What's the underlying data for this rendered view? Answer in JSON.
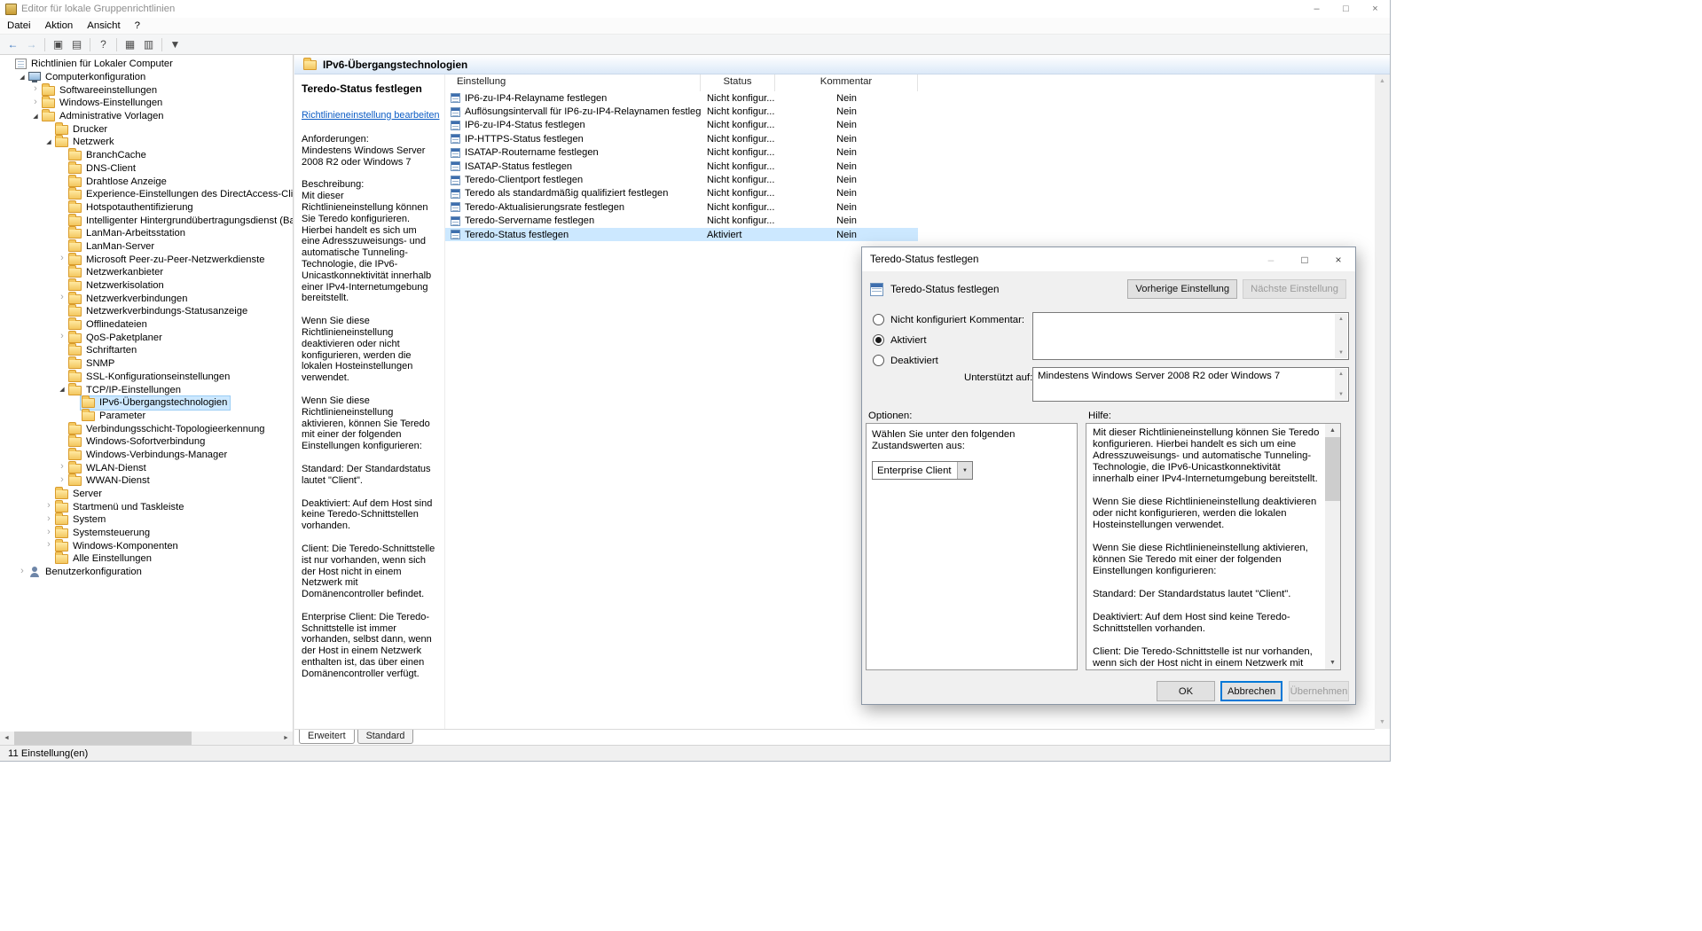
{
  "colors": {
    "selection_blue": "#cce8ff",
    "link_blue": "#0a5bc4",
    "accent_blue": "#0078d7",
    "folder_yellow": "#f3c75f"
  },
  "window": {
    "title": "Editor für lokale Gruppenrichtlinien",
    "menus": [
      "Datei",
      "Aktion",
      "Ansicht",
      "?"
    ],
    "status": "11 Einstellung(en)",
    "caption_buttons": [
      {
        "name": "minimize-button",
        "glyph": "–"
      },
      {
        "name": "maximize-button",
        "glyph": "□"
      },
      {
        "name": "close-button",
        "glyph": "×"
      }
    ],
    "toolbar": [
      {
        "name": "back-icon",
        "glyph": "←"
      },
      {
        "name": "forward-icon",
        "glyph": "→"
      },
      {
        "name": "separator"
      },
      {
        "name": "show-console-tree-icon",
        "glyph": "▣"
      },
      {
        "name": "export-list-icon",
        "glyph": "▤"
      },
      {
        "name": "separator"
      },
      {
        "name": "help-icon",
        "glyph": "?"
      },
      {
        "name": "separator"
      },
      {
        "name": "icon-view-icon",
        "glyph": "▦"
      },
      {
        "name": "list-view-icon",
        "glyph": "▥"
      },
      {
        "name": "separator"
      },
      {
        "name": "filter-icon",
        "glyph": "▼"
      }
    ]
  },
  "tree": [
    {
      "label": "Richtlinien für Lokaler Computer",
      "depth": 0,
      "chevron": "none",
      "icon": "console"
    },
    {
      "label": "Computerkonfiguration",
      "depth": 1,
      "chevron": "open",
      "icon": "computer"
    },
    {
      "label": "Softwareeinstellungen",
      "depth": 2,
      "chevron": "closed",
      "icon": "folder"
    },
    {
      "label": "Windows-Einstellungen",
      "depth": 2,
      "chevron": "closed",
      "icon": "folder"
    },
    {
      "label": "Administrative Vorlagen",
      "depth": 2,
      "chevron": "open",
      "icon": "folder"
    },
    {
      "label": "Drucker",
      "depth": 3,
      "chevron": "none",
      "icon": "folder"
    },
    {
      "label": "Netzwerk",
      "depth": 3,
      "chevron": "open",
      "icon": "folder"
    },
    {
      "label": "BranchCache",
      "depth": 4,
      "chevron": "none",
      "icon": "folder"
    },
    {
      "label": "DNS-Client",
      "depth": 4,
      "chevron": "none",
      "icon": "folder"
    },
    {
      "label": "Drahtlose Anzeige",
      "depth": 4,
      "chevron": "none",
      "icon": "folder"
    },
    {
      "label": "Experience-Einstellungen des DirectAccess-Clients",
      "depth": 4,
      "chevron": "none",
      "icon": "folder"
    },
    {
      "label": "Hotspotauthentifizierung",
      "depth": 4,
      "chevron": "none",
      "icon": "folder"
    },
    {
      "label": "Intelligenter Hintergrundübertragungsdienst (Backgroun",
      "depth": 4,
      "chevron": "none",
      "icon": "folder"
    },
    {
      "label": "LanMan-Arbeitsstation",
      "depth": 4,
      "chevron": "none",
      "icon": "folder"
    },
    {
      "label": "LanMan-Server",
      "depth": 4,
      "chevron": "none",
      "icon": "folder"
    },
    {
      "label": "Microsoft Peer-zu-Peer-Netzwerkdienste",
      "depth": 4,
      "chevron": "closed",
      "icon": "folder"
    },
    {
      "label": "Netzwerkanbieter",
      "depth": 4,
      "chevron": "none",
      "icon": "folder"
    },
    {
      "label": "Netzwerkisolation",
      "depth": 4,
      "chevron": "none",
      "icon": "folder"
    },
    {
      "label": "Netzwerkverbindungen",
      "depth": 4,
      "chevron": "closed",
      "icon": "folder"
    },
    {
      "label": "Netzwerkverbindungs-Statusanzeige",
      "depth": 4,
      "chevron": "none",
      "icon": "folder"
    },
    {
      "label": "Offlinedateien",
      "depth": 4,
      "chevron": "none",
      "icon": "folder"
    },
    {
      "label": "QoS-Paketplaner",
      "depth": 4,
      "chevron": "closed",
      "icon": "folder"
    },
    {
      "label": "Schriftarten",
      "depth": 4,
      "chevron": "none",
      "icon": "folder"
    },
    {
      "label": "SNMP",
      "depth": 4,
      "chevron": "none",
      "icon": "folder"
    },
    {
      "label": "SSL-Konfigurationseinstellungen",
      "depth": 4,
      "chevron": "none",
      "icon": "folder"
    },
    {
      "label": "TCP/IP-Einstellungen",
      "depth": 4,
      "chevron": "open",
      "icon": "folder"
    },
    {
      "label": "IPv6-Übergangstechnologien",
      "depth": 5,
      "chevron": "none",
      "icon": "folder",
      "selected": true
    },
    {
      "label": "Parameter",
      "depth": 5,
      "chevron": "none",
      "icon": "folder"
    },
    {
      "label": "Verbindungsschicht-Topologieerkennung",
      "depth": 4,
      "chevron": "none",
      "icon": "folder"
    },
    {
      "label": "Windows-Sofortverbindung",
      "depth": 4,
      "chevron": "none",
      "icon": "folder"
    },
    {
      "label": "Windows-Verbindungs-Manager",
      "depth": 4,
      "chevron": "none",
      "icon": "folder"
    },
    {
      "label": "WLAN-Dienst",
      "depth": 4,
      "chevron": "closed",
      "icon": "folder"
    },
    {
      "label": "WWAN-Dienst",
      "depth": 4,
      "chevron": "closed",
      "icon": "folder"
    },
    {
      "label": "Server",
      "depth": 3,
      "chevron": "none",
      "icon": "folder"
    },
    {
      "label": "Startmenü und Taskleiste",
      "depth": 3,
      "chevron": "closed",
      "icon": "folder"
    },
    {
      "label": "System",
      "depth": 3,
      "chevron": "closed",
      "icon": "folder"
    },
    {
      "label": "Systemsteuerung",
      "depth": 3,
      "chevron": "closed",
      "icon": "folder"
    },
    {
      "label": "Windows-Komponenten",
      "depth": 3,
      "chevron": "closed",
      "icon": "folder"
    },
    {
      "label": "Alle Einstellungen",
      "depth": 3,
      "chevron": "none",
      "icon": "folder"
    },
    {
      "label": "Benutzerkonfiguration",
      "depth": 1,
      "chevron": "closed",
      "icon": "user"
    }
  ],
  "content": {
    "header": "IPv6-Übergangstechnologien",
    "tabs": [
      "Erweitert",
      "Standard"
    ],
    "selected_tab": "Erweitert",
    "description": {
      "title": "Teredo-Status festlegen",
      "edit_link": "Richtlinieneinstellung bearbeiten",
      "paragraphs": [
        "Anforderungen:\nMindestens Windows Server 2008 R2 oder Windows 7",
        "Beschreibung:\nMit dieser Richtlinieneinstellung können Sie Teredo konfigurieren. Hierbei handelt es sich um eine Adresszuweisungs- und automatische Tunneling-Technologie, die IPv6-Unicastkonnektivität innerhalb einer IPv4-Internetumgebung bereitstellt.",
        "Wenn Sie diese Richtlinieneinstellung deaktivieren oder nicht konfigurieren, werden die lokalen Hosteinstellungen verwendet.",
        "Wenn Sie diese Richtlinieneinstellung aktivieren, können Sie Teredo mit einer der folgenden Einstellungen konfigurieren:",
        "Standard: Der Standardstatus lautet \"Client\".",
        "Deaktiviert: Auf dem Host sind keine Teredo-Schnittstellen vorhanden.",
        "Client: Die Teredo-Schnittstelle ist nur vorhanden, wenn sich der Host nicht in einem Netzwerk mit Domänencontroller befindet.",
        "Enterprise Client: Die Teredo-Schnittstelle ist immer vorhanden, selbst dann, wenn der Host in einem Netzwerk enthalten ist, das über einen Domänencontroller verfügt."
      ]
    },
    "list": {
      "columns": [
        "Einstellung",
        "Status",
        "Kommentar"
      ],
      "rows": [
        {
          "setting": "IP6-zu-IP4-Relayname festlegen",
          "status": "Nicht konfigur...",
          "comment": "Nein"
        },
        {
          "setting": "Auflösungsintervall für IP6-zu-IP4-Relaynamen festlegen",
          "status": "Nicht konfigur...",
          "comment": "Nein"
        },
        {
          "setting": "IP6-zu-IP4-Status festlegen",
          "status": "Nicht konfigur...",
          "comment": "Nein"
        },
        {
          "setting": "IP-HTTPS-Status festlegen",
          "status": "Nicht konfigur...",
          "comment": "Nein"
        },
        {
          "setting": "ISATAP-Routername festlegen",
          "status": "Nicht konfigur...",
          "comment": "Nein"
        },
        {
          "setting": "ISATAP-Status festlegen",
          "status": "Nicht konfigur...",
          "comment": "Nein"
        },
        {
          "setting": "Teredo-Clientport festlegen",
          "status": "Nicht konfigur...",
          "comment": "Nein"
        },
        {
          "setting": "Teredo als standardmäßig qualifiziert festlegen",
          "status": "Nicht konfigur...",
          "comment": "Nein"
        },
        {
          "setting": "Teredo-Aktualisierungsrate festlegen",
          "status": "Nicht konfigur...",
          "comment": "Nein"
        },
        {
          "setting": "Teredo-Servername festlegen",
          "status": "Nicht konfigur...",
          "comment": "Nein"
        },
        {
          "setting": "Teredo-Status festlegen",
          "status": "Aktiviert",
          "comment": "Nein",
          "selected": true
        }
      ]
    }
  },
  "dialog": {
    "title": "Teredo-Status festlegen",
    "setting_label": "Teredo-Status festlegen",
    "caption_buttons": [
      {
        "name": "minimize-button",
        "glyph": "–"
      },
      {
        "name": "maximize-button",
        "glyph": "□"
      },
      {
        "name": "close-button",
        "glyph": "×"
      }
    ],
    "prev_button": "Vorherige Einstellung",
    "next_button": "Nächste Einstellung",
    "radios": [
      {
        "label": "Nicht konfiguriert",
        "checked": false
      },
      {
        "label": "Aktiviert",
        "checked": true
      },
      {
        "label": "Deaktiviert",
        "checked": false
      }
    ],
    "comment_label": "Kommentar:",
    "comment_value": "",
    "supported_label": "Unterstützt auf:",
    "supported_value": "Mindestens Windows Server 2008 R2 oder Windows 7",
    "options_label": "Optionen:",
    "help_label": "Hilfe:",
    "options_text": "Wählen Sie unter den folgenden Zustandswerten aus:",
    "dropdown_value": "Enterprise Client",
    "help_paragraphs": [
      "Mit dieser Richtlinieneinstellung können Sie Teredo konfigurieren. Hierbei handelt es sich um eine Adresszuweisungs- und automatische Tunneling-Technologie, die IPv6-Unicastkonnektivität innerhalb einer IPv4-Internetumgebung bereitstellt.",
      "Wenn Sie diese Richtlinieneinstellung deaktivieren oder nicht konfigurieren, werden die lokalen Hosteinstellungen verwendet.",
      "Wenn Sie diese Richtlinieneinstellung aktivieren, können Sie Teredo mit einer der folgenden Einstellungen konfigurieren:",
      "Standard: Der Standardstatus lautet \"Client\".",
      "Deaktiviert: Auf dem Host sind keine Teredo-Schnittstellen vorhanden.",
      "Client: Die Teredo-Schnittstelle ist nur vorhanden, wenn sich der Host nicht in einem Netzwerk mit Domänencontroller befindet.",
      "Enterprise Client: Die Teredo-Schnittstelle ist immer vorhanden, selbst dann, wenn der Host in einem Netzwerk enthalten ist, das über einen Domänencontroller verfügt."
    ],
    "buttons": {
      "ok": "OK",
      "cancel": "Abbrechen",
      "apply": "Übernehmen"
    }
  }
}
